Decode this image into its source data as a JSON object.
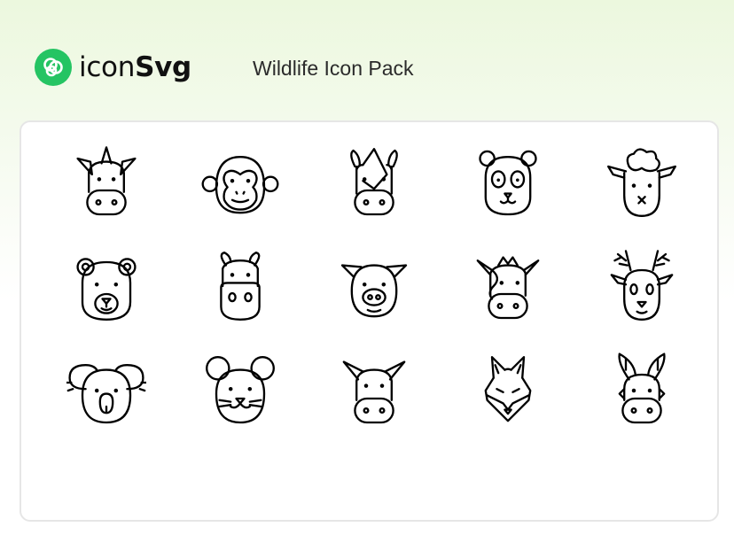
{
  "brand": {
    "name_light": "icon",
    "name_bold": "Svg",
    "logo_icon": "iconsvg-logo-icon",
    "accent_color": "#25c463"
  },
  "pack_title": "Wildlife Icon Pack",
  "icons": [
    {
      "name": "unicorn-icon"
    },
    {
      "name": "monkey-icon"
    },
    {
      "name": "rhino-icon"
    },
    {
      "name": "panda-icon"
    },
    {
      "name": "sheep-icon"
    },
    {
      "name": "bear-icon"
    },
    {
      "name": "hippo-icon"
    },
    {
      "name": "pig-icon"
    },
    {
      "name": "cow-icon"
    },
    {
      "name": "deer-icon"
    },
    {
      "name": "koala-icon"
    },
    {
      "name": "mouse-icon"
    },
    {
      "name": "horse-icon"
    },
    {
      "name": "fox-icon"
    },
    {
      "name": "donkey-icon"
    }
  ]
}
